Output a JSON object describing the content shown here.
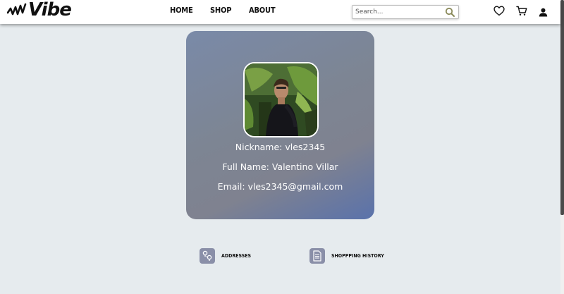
{
  "header": {
    "logo_text": "Vibe",
    "nav": [
      {
        "label": "HOME"
      },
      {
        "label": "SHOP"
      },
      {
        "label": "ABOUT"
      }
    ],
    "search": {
      "placeholder": "Search..."
    },
    "icons": [
      "heart-icon",
      "cart-icon",
      "user-icon"
    ]
  },
  "profile": {
    "nickname": "Nickname: vles2345",
    "full_name": "Full Name: Valentino Villar",
    "email": "Email: vles2345@gmail.com"
  },
  "actions": [
    {
      "label": "ADDRESSES",
      "icon": "map-pin-icon"
    },
    {
      "label": "SHOPPPING HISTORY",
      "icon": "document-icon"
    }
  ],
  "colors": {
    "background": "#e6ebee",
    "card_start": "#7a8aa8",
    "card_end": "#5a72ab",
    "tile_icon": "#8a8fa8",
    "search_accent": "#8a8a5a"
  }
}
